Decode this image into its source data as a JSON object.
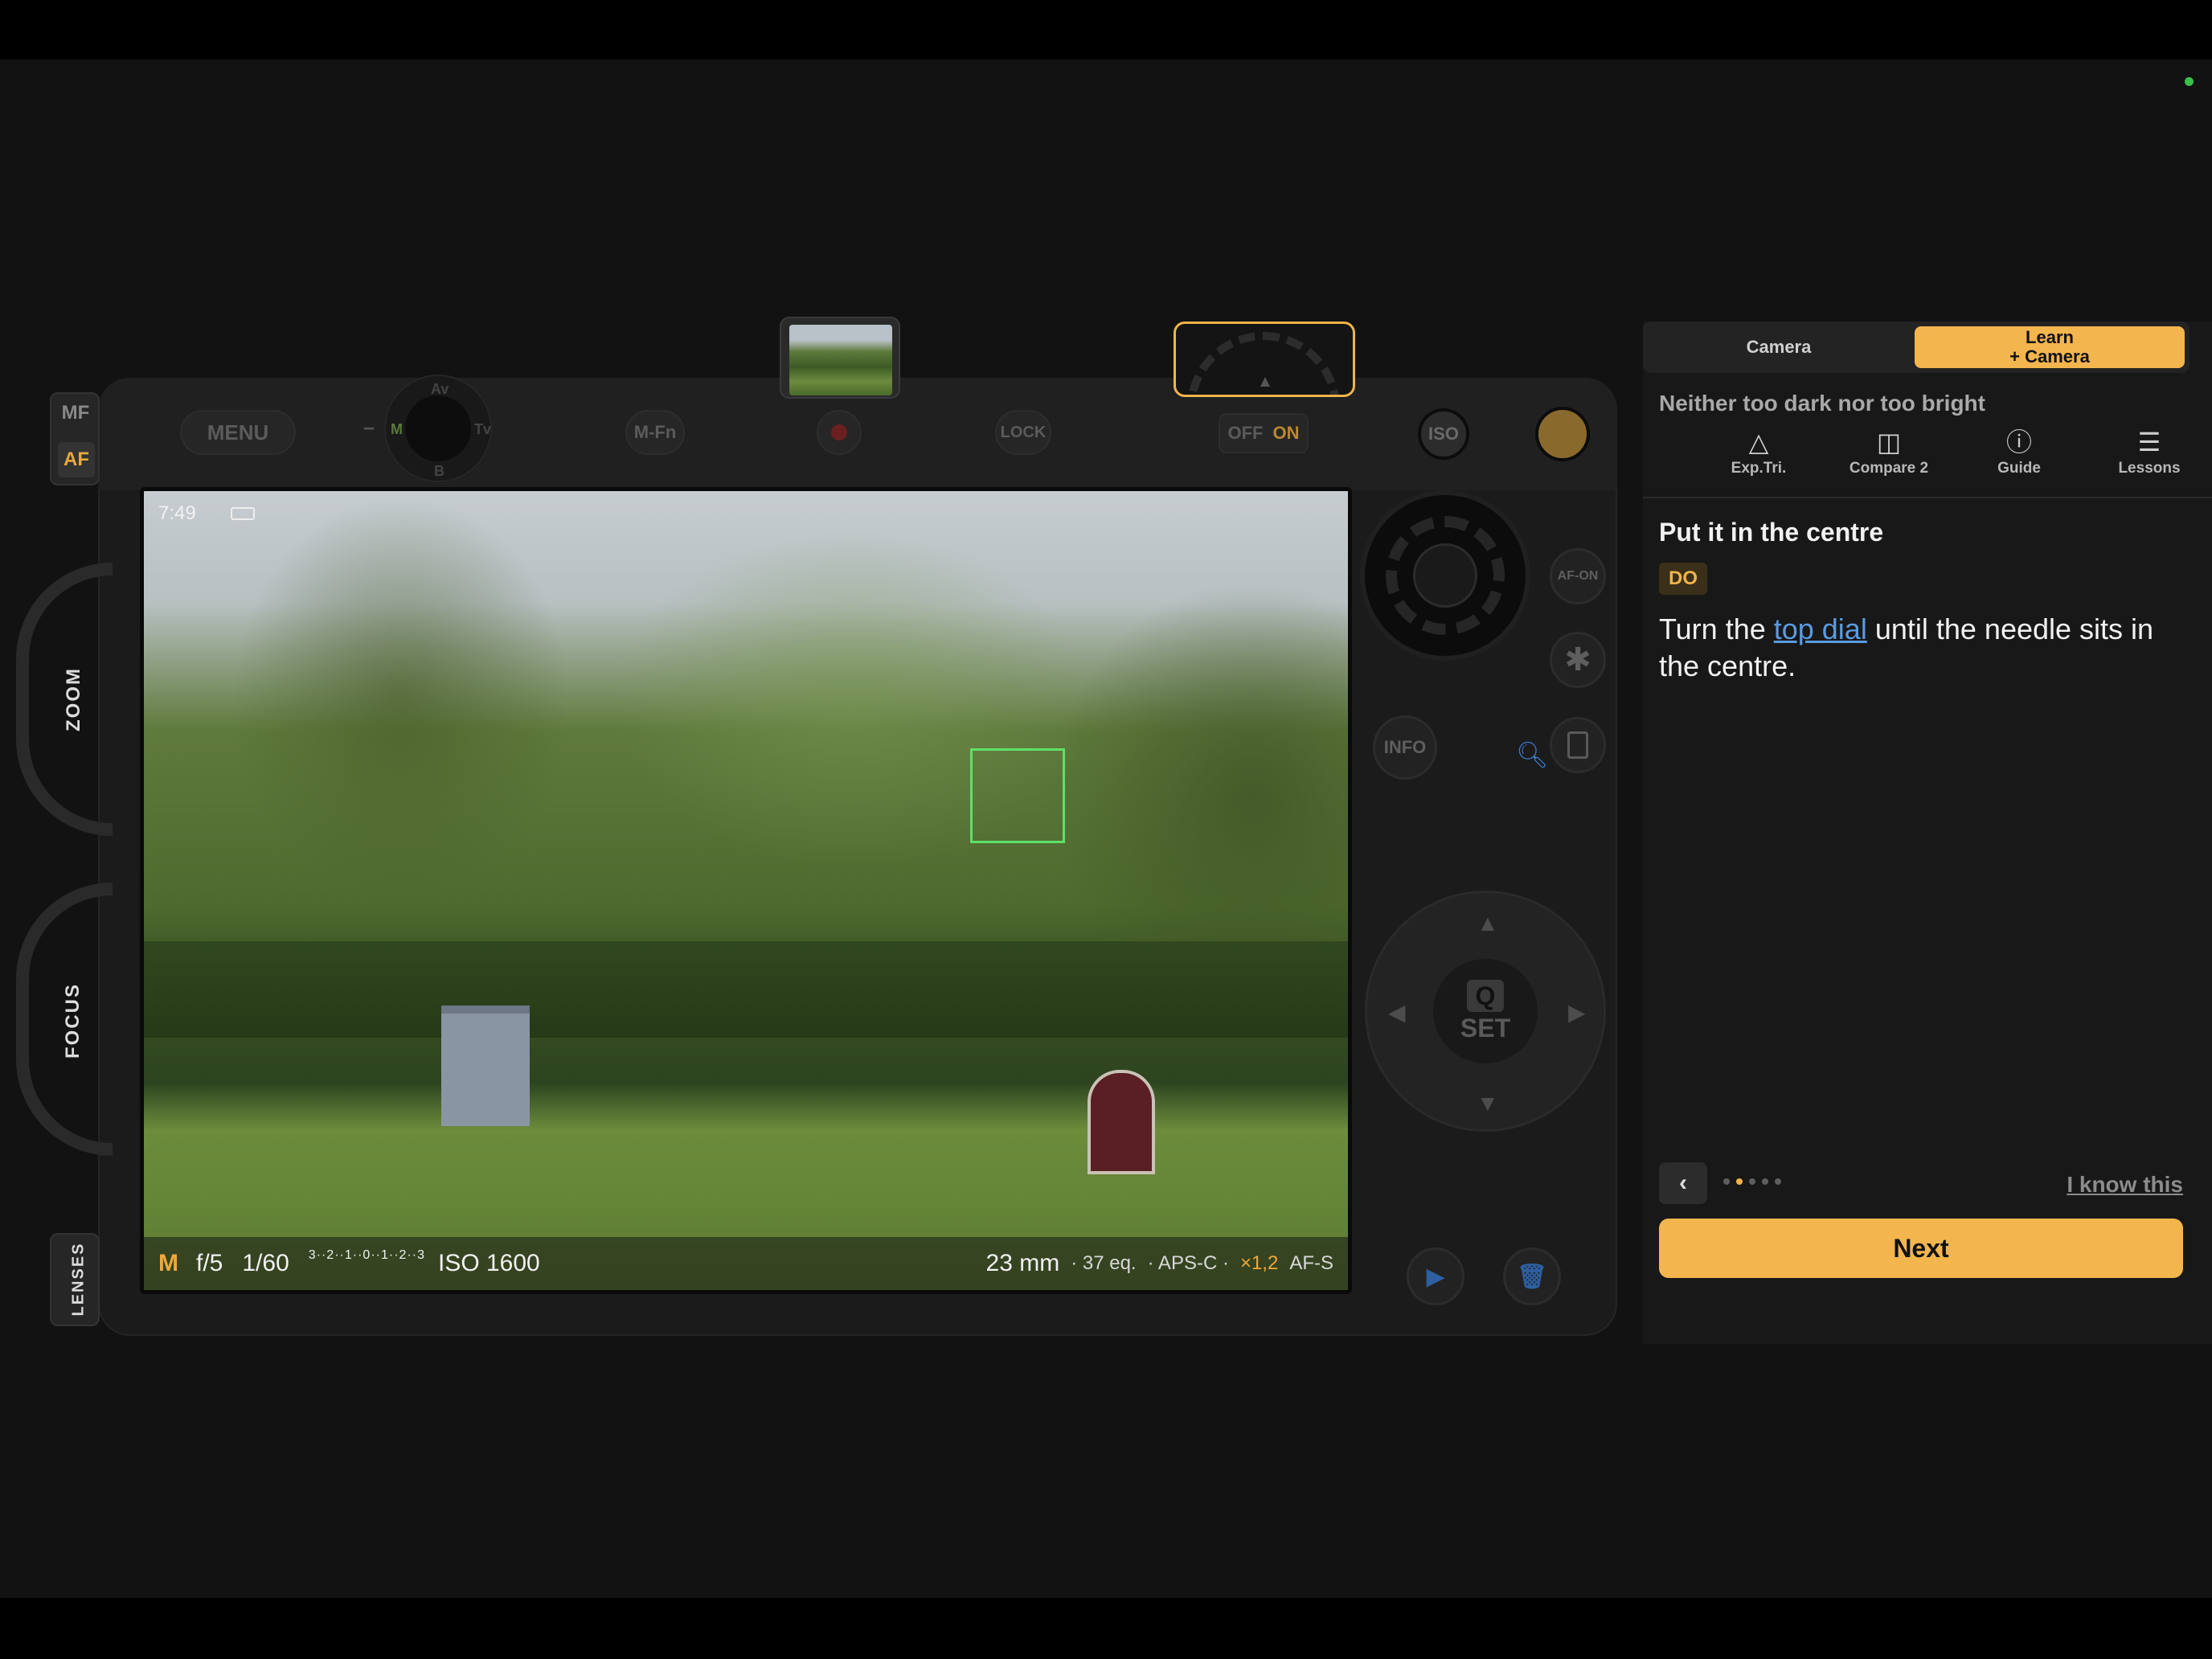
{
  "camera": {
    "menu_label": "MENU",
    "mfn_label": "M-Fn",
    "lock_label": "LOCK",
    "power": {
      "off": "OFF",
      "on": "ON"
    },
    "iso_label": "ISO",
    "mode_dial": {
      "av": "Av",
      "m": "M",
      "tv": "Tv",
      "b": "B",
      "minus": "−"
    },
    "focus_mode": {
      "mf": "MF",
      "af": "AF"
    },
    "zoom_label": "ZOOM",
    "focus_label": "FOCUS",
    "lenses_label": "LENSES",
    "af_on_label": "AF-ON",
    "star_label": "✱",
    "info_label": "INFO",
    "dpad": {
      "q": "Q",
      "set": "SET"
    },
    "icons": {
      "magnifier": "search-icon",
      "play": "play-icon",
      "trash": "trash-icon"
    },
    "accent_color": "#F3B54E"
  },
  "viewfinder": {
    "time": "7:49",
    "mode": "M",
    "aperture": "f/5",
    "shutter": "1/60",
    "exposure_scale": "3··2··1··0··1··2··3",
    "iso": "ISO 1600",
    "focal_length": "23 mm",
    "equivalent": "· 37 eq.",
    "sensor": "· APS-C ·",
    "crop": "×1,2",
    "af_mode": "AF-S"
  },
  "panel": {
    "tabs": {
      "camera": "Camera",
      "learn_line1": "Learn",
      "learn_line2": "+ Camera"
    },
    "subtitle": "Neither too dark nor too bright",
    "tools": [
      {
        "label": "Exp.Tri.",
        "icon": "triangle-icon"
      },
      {
        "label": "Compare 2",
        "icon": "split-view-icon"
      },
      {
        "label": "Guide",
        "icon": "help-icon"
      },
      {
        "label": "Lessons",
        "icon": "list-icon"
      }
    ],
    "lesson_title": "Put it in the centre",
    "badge": "DO",
    "body_before": "Turn the ",
    "body_link": "top dial",
    "body_after": " until the needle sits in the centre.",
    "progress": {
      "current": 2,
      "total": 5
    },
    "know_label": "I know this",
    "next_label": "Next"
  }
}
